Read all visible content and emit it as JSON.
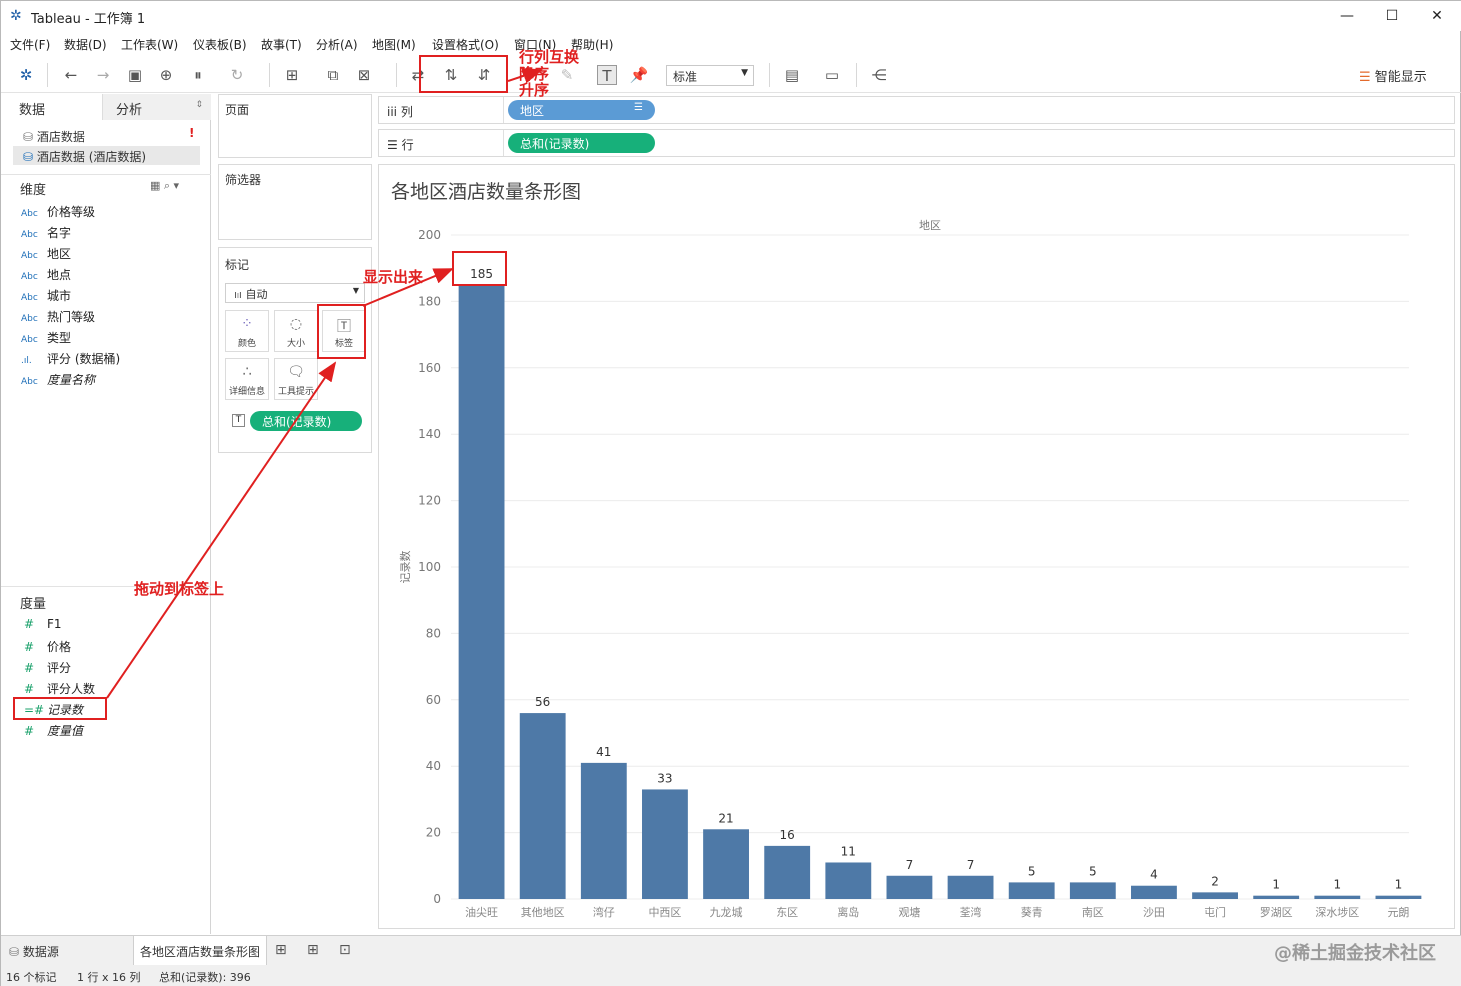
{
  "window": {
    "title": "Tableau - 工作簿 1"
  },
  "menu": [
    "文件(F)",
    "数据(D)",
    "工作表(W)",
    "仪表板(B)",
    "故事(T)",
    "分析(A)",
    "地图(M)",
    "设置格式(O)",
    "窗口(N)",
    "帮助(H)"
  ],
  "toolbar": {
    "fit_select": "标准",
    "show_me": "智能显示"
  },
  "left": {
    "tab_data": "数据",
    "tab_analysis": "分析",
    "datasource_1": "酒店数据",
    "datasource_2": "酒店数据 (酒店数据)",
    "dimensions_label": "维度",
    "dimensions": [
      "价格等级",
      "名字",
      "地区",
      "地点",
      "城市",
      "热门等级",
      "类型",
      "评分 (数据桶)",
      "度量名称"
    ],
    "measures_label": "度量",
    "measures": [
      "F1",
      "价格",
      "评分",
      "评分人数",
      "记录数",
      "度量值"
    ],
    "abc": "Abc"
  },
  "cards": {
    "pages": "页面",
    "filters": "筛选器",
    "marks": "标记",
    "mark_type": "自动",
    "color": "颜色",
    "size": "大小",
    "label": "标签",
    "detail": "详细信息",
    "tooltip": "工具提示",
    "mark_pill": "总和(记录数)"
  },
  "shelves": {
    "columns_label": "列",
    "columns_pill": "地区",
    "rows_label": "行",
    "rows_pill": "总和(记录数)"
  },
  "chart_data": {
    "type": "bar",
    "title": "各地区酒店数量条形图",
    "xlabel": "地区",
    "ylabel": "记录数",
    "ylim": [
      0,
      200
    ],
    "yticks": [
      0,
      20,
      40,
      60,
      80,
      100,
      120,
      140,
      160,
      180,
      200
    ],
    "categories": [
      "油尖旺",
      "其他地区",
      "湾仔",
      "中西区",
      "九龙城",
      "东区",
      "离岛",
      "观塘",
      "荃湾",
      "葵青",
      "南区",
      "沙田",
      "屯门",
      "罗湖区",
      "深水埗区",
      "元朗"
    ],
    "values": [
      185,
      56,
      41,
      33,
      21,
      16,
      11,
      7,
      7,
      5,
      5,
      4,
      2,
      1,
      1,
      1
    ],
    "bar_color": "#4e79a7",
    "grid": true
  },
  "sheets": {
    "datasource_tab": "数据源",
    "sheet_tab": "各地区酒店数量条形图"
  },
  "status": {
    "marks": "16 个标记",
    "grid": "1 行 x 16 列",
    "sum": "总和(记录数): 396"
  },
  "annotations": {
    "swap": "行列互换",
    "desc": "降序",
    "asc": "升序",
    "show": "显示出来",
    "drag": "拖动到标签上"
  },
  "watermark": "@稀土掘金技术社区",
  "colors": {
    "blue_pill": "#5b9bd5",
    "green_pill": "#17b07a",
    "annotation": "#e02020"
  }
}
